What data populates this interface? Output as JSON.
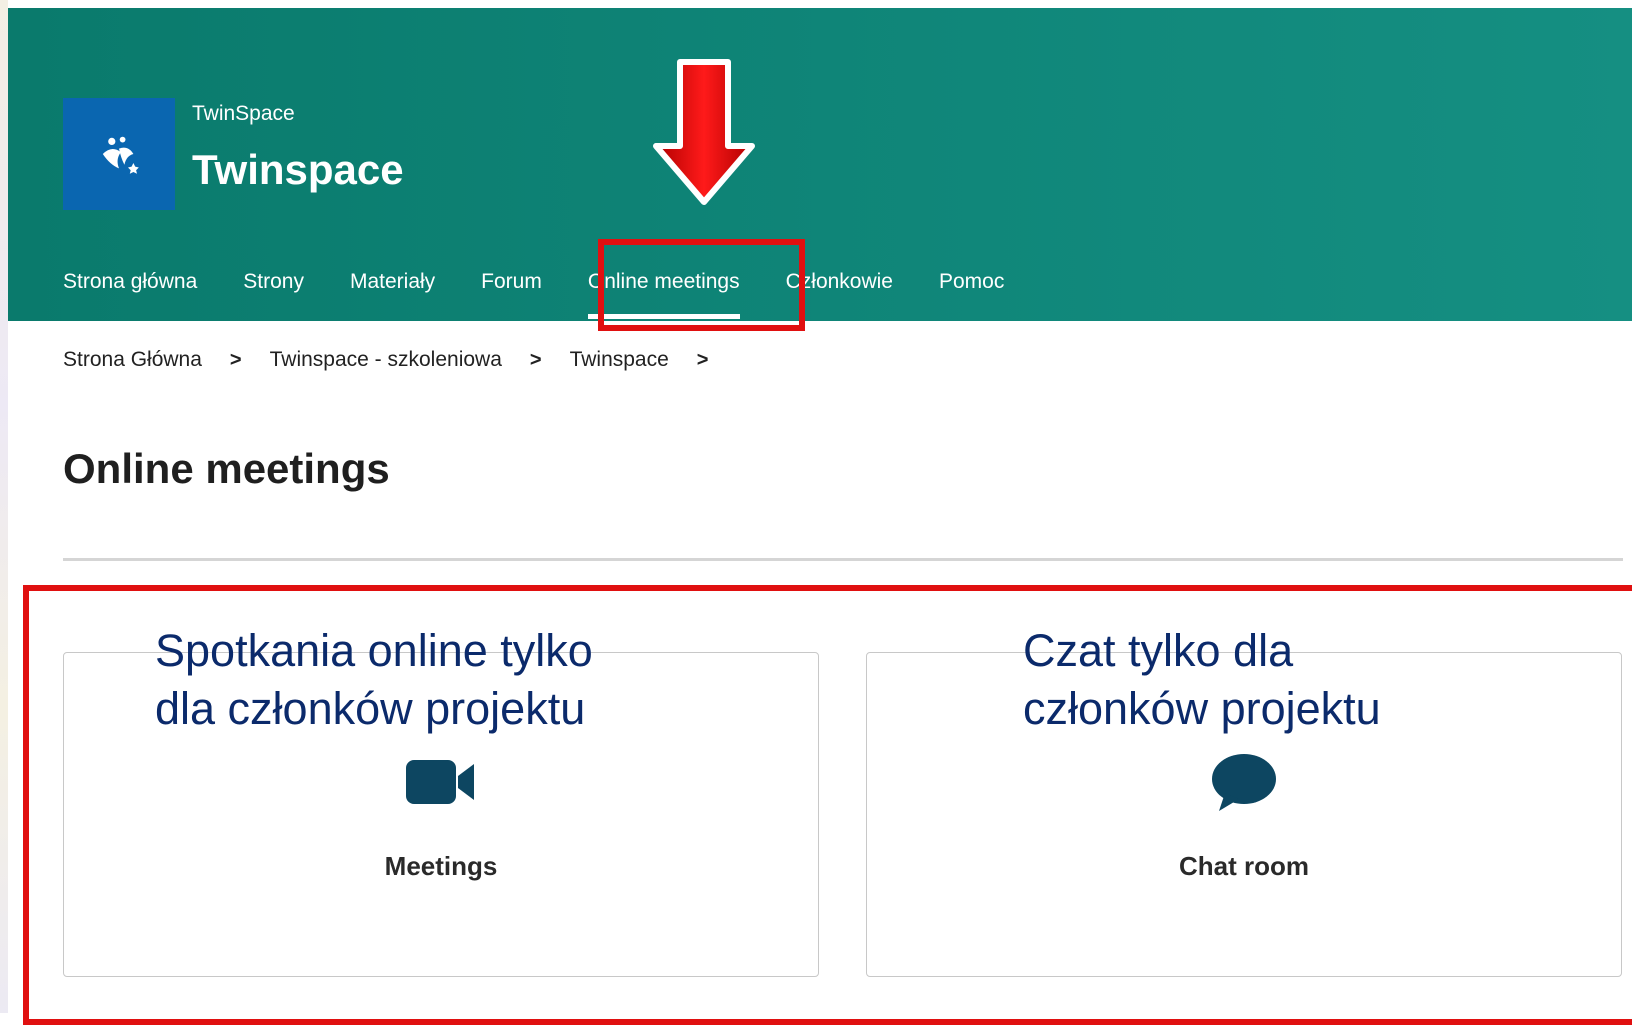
{
  "header": {
    "site_kicker": "TwinSpace",
    "site_title": "Twinspace"
  },
  "nav": {
    "items": [
      {
        "label": "Strona główna"
      },
      {
        "label": "Strony"
      },
      {
        "label": "Materiały"
      },
      {
        "label": "Forum"
      },
      {
        "label": "Online meetings",
        "active": true
      },
      {
        "label": "Członkowie"
      },
      {
        "label": "Pomoc"
      }
    ]
  },
  "breadcrumb": {
    "items": [
      "Strona Główna",
      "Twinspace - szkoleniowa",
      "Twinspace"
    ],
    "separator": ">"
  },
  "page": {
    "title": "Online meetings"
  },
  "cards": [
    {
      "label": "Meetings",
      "icon": "video-camera-icon"
    },
    {
      "label": "Chat room",
      "icon": "chat-bubble-icon"
    }
  ],
  "annotations": {
    "meetings_note": "Spotkania online tylko\ndla członków projektu",
    "chat_note": "Czat tylko dla\nczłonków projektu"
  },
  "colors": {
    "header_green": "#0f8474",
    "logo_blue": "#0a66b0",
    "highlight_red": "#e01010",
    "icon_navy": "#0d4661",
    "annotation_blue": "#0b2a6b"
  }
}
